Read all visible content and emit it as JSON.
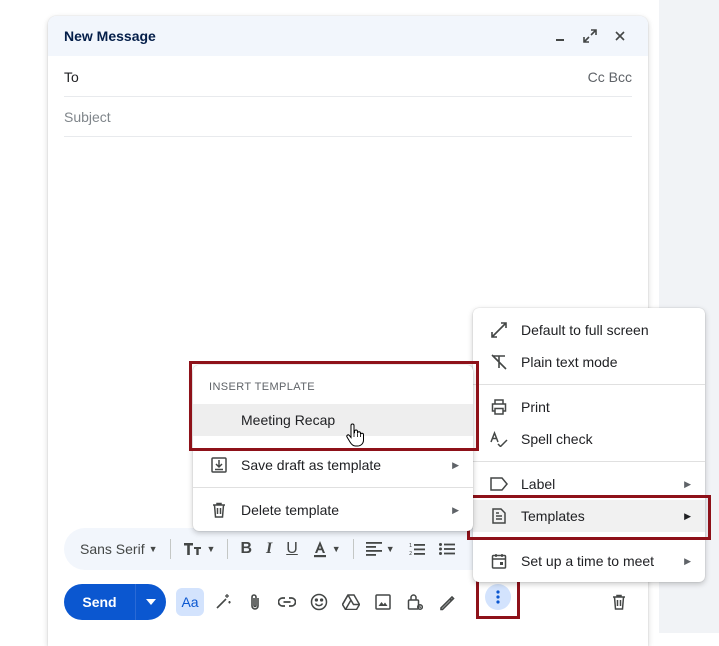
{
  "compose": {
    "title": "New Message",
    "to_label": "To",
    "ccbcc_label": "Cc Bcc",
    "subject_placeholder": "Subject"
  },
  "format_bar": {
    "font": "Sans Serif"
  },
  "bottom_bar": {
    "send_label": "Send",
    "text_format_label": "Aa"
  },
  "more_menu": {
    "items": [
      {
        "label": "Default to full screen",
        "icon": "expand-icon"
      },
      {
        "label": "Plain text mode",
        "icon": "plain-text-icon"
      },
      {
        "label": "Print",
        "icon": "print-icon"
      },
      {
        "label": "Spell check",
        "icon": "spellcheck-icon"
      },
      {
        "label": "Label",
        "icon": "label-icon"
      },
      {
        "label": "Templates",
        "icon": "templates-icon"
      },
      {
        "label": "Set up a time to meet",
        "icon": "calendar-icon"
      }
    ]
  },
  "templates_submenu": {
    "heading": "INSERT TEMPLATE",
    "template_name": "Meeting Recap",
    "save_label": "Save draft as template",
    "delete_label": "Delete template"
  },
  "colors": {
    "header_bg": "#f2f6fc",
    "send_blue": "#0b57d0",
    "highlight_red": "#8e1119"
  }
}
